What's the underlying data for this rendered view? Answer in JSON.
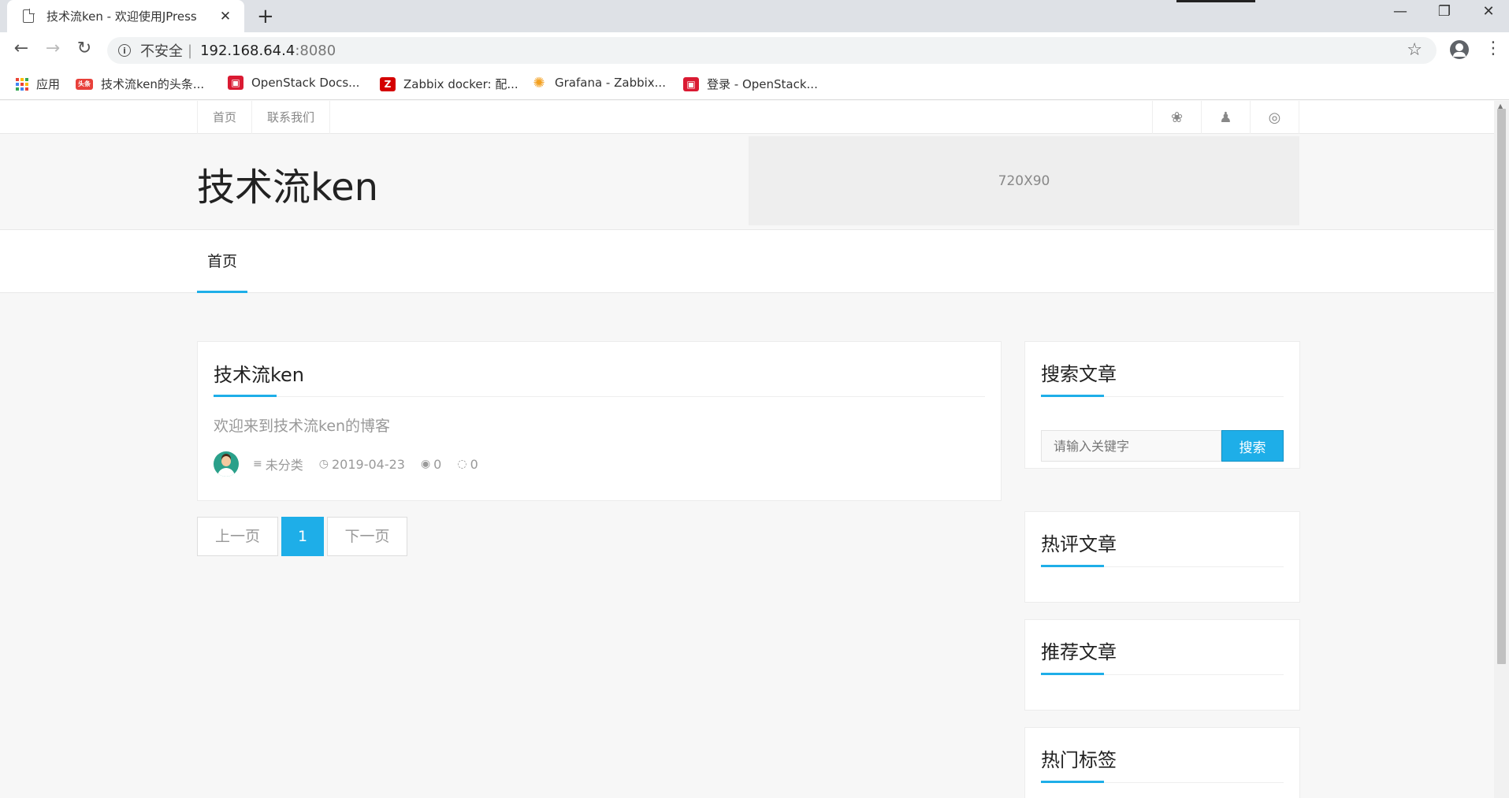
{
  "browser": {
    "tab_title": "技术流ken - 欢迎使用JPress",
    "tab_close": "✕",
    "new_tab": "+",
    "window_controls": {
      "minimize": "—",
      "maximize": "❐",
      "close": "✕"
    },
    "nav": {
      "back": "←",
      "forward": "→",
      "reload": "↻"
    },
    "security_label": "不安全",
    "separator": "|",
    "url_host": "192.168.64.4",
    "url_port": ":8080",
    "star": "☆",
    "menu": "⋮"
  },
  "bookmarks": [
    {
      "label": "应用",
      "icon": "apps-grid-icon"
    },
    {
      "label": "技术流ken的头条...",
      "icon": "toutiao-icon",
      "logo": "头条"
    },
    {
      "label": "OpenStack Docs...",
      "icon": "openstack-icon",
      "logo": "▣"
    },
    {
      "label": "Zabbix docker: 配...",
      "icon": "zabbix-icon",
      "logo": "Z"
    },
    {
      "label": "Grafana - Zabbix...",
      "icon": "grafana-icon",
      "logo": "✺"
    },
    {
      "label": "登录 - OpenStack...",
      "icon": "openstack-icon",
      "logo": "▣"
    }
  ],
  "apps_colors": [
    "#ea4335",
    "#fbbc05",
    "#34a853",
    "#4285f4",
    "#ea4335",
    "#fbbc05",
    "#34a853",
    "#4285f4",
    "#ea4335"
  ],
  "site": {
    "topnav": [
      "首页",
      "联系我们"
    ],
    "social": {
      "wechat": "❀",
      "qq": "♟",
      "weibo": "◎"
    },
    "title": "技术流ken",
    "ad_text": "720X90",
    "mainnav": [
      "首页"
    ]
  },
  "post": {
    "title": "技术流ken",
    "excerpt": "欢迎来到技术流ken的博客",
    "category": "未分类",
    "date": "2019-04-23",
    "views": "0",
    "comments": "0",
    "icons": {
      "category": "≡",
      "date": "◷",
      "views": "◉",
      "comments": "◌"
    }
  },
  "pager": {
    "prev": "上一页",
    "current": "1",
    "next": "下一页"
  },
  "sidebar": {
    "search": {
      "title": "搜索文章",
      "placeholder": "请输入关键字",
      "button": "搜索"
    },
    "hot_comments": {
      "title": "热评文章"
    },
    "recommended": {
      "title": "推荐文章"
    },
    "hot_tags": {
      "title": "热门标签"
    }
  },
  "colors": {
    "accent": "#1eaee8"
  }
}
